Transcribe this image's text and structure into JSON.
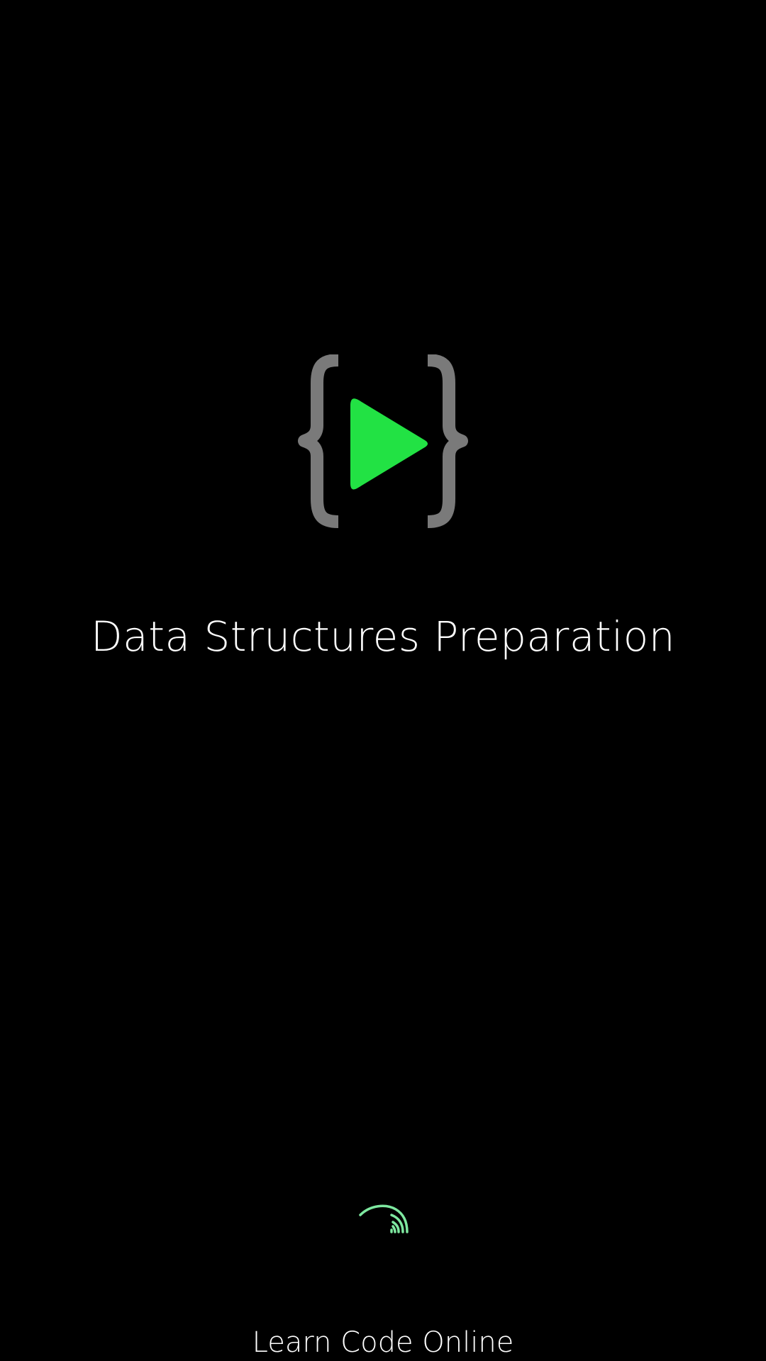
{
  "splash": {
    "title": "Data Structures Preparation",
    "footer": "Learn Code Online",
    "logo_icon": "braces-play-icon",
    "spinner_icon": "loading-spinner-icon"
  },
  "colors": {
    "background": "#000000",
    "brace": "#7a7a7a",
    "play": "#22e244",
    "spinner": "#7ee8a0",
    "text": "#ffffff"
  }
}
